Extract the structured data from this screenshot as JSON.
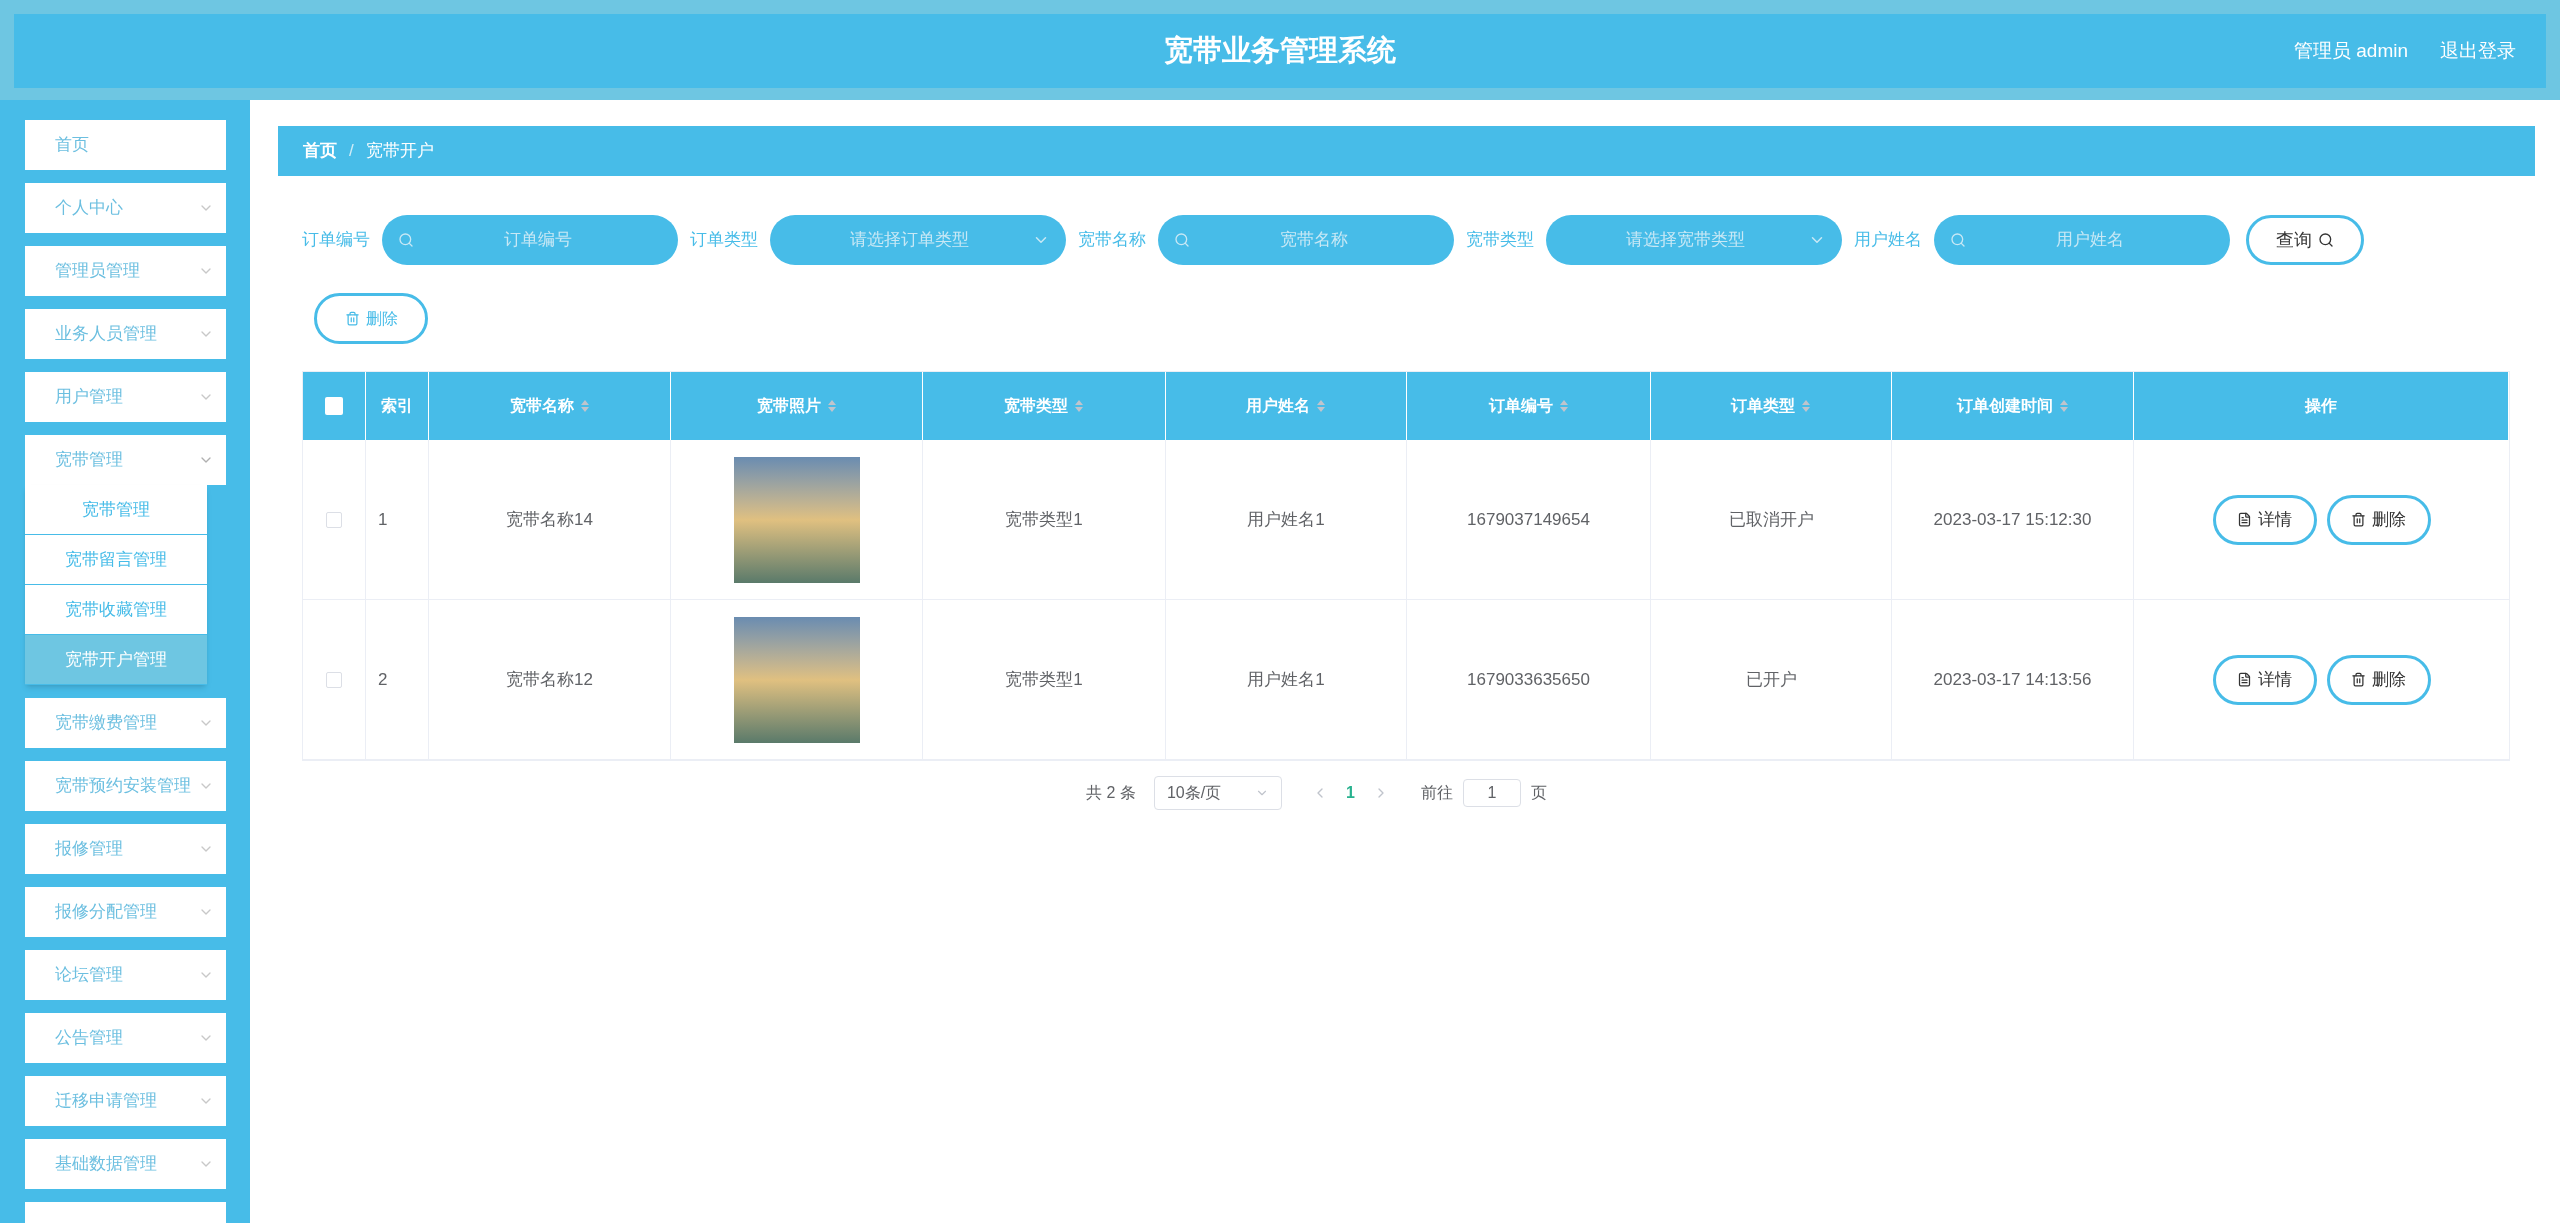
{
  "header": {
    "title": "宽带业务管理系统",
    "user": "管理员 admin",
    "logout": "退出登录"
  },
  "sidebar": {
    "items": [
      {
        "label": "首页",
        "kind": "link"
      },
      {
        "label": "个人中心",
        "kind": "menu",
        "expanded": false
      },
      {
        "label": "管理员管理",
        "kind": "menu",
        "expanded": false
      },
      {
        "label": "业务人员管理",
        "kind": "menu",
        "expanded": false
      },
      {
        "label": "用户管理",
        "kind": "menu",
        "expanded": false
      },
      {
        "label": "宽带管理",
        "kind": "menu",
        "expanded": true,
        "children": [
          {
            "label": "宽带管理",
            "selected": false
          },
          {
            "label": "宽带留言管理",
            "selected": false
          },
          {
            "label": "宽带收藏管理",
            "selected": false
          },
          {
            "label": "宽带开户管理",
            "selected": true
          }
        ]
      },
      {
        "label": "宽带缴费管理",
        "kind": "menu",
        "expanded": false
      },
      {
        "label": "宽带预约安装管理",
        "kind": "menu",
        "expanded": false
      },
      {
        "label": "报修管理",
        "kind": "menu",
        "expanded": false
      },
      {
        "label": "报修分配管理",
        "kind": "menu",
        "expanded": false
      },
      {
        "label": "论坛管理",
        "kind": "menu",
        "expanded": false
      },
      {
        "label": "公告管理",
        "kind": "menu",
        "expanded": false
      },
      {
        "label": "迁移申请管理",
        "kind": "menu",
        "expanded": false
      },
      {
        "label": "基础数据管理",
        "kind": "menu",
        "expanded": false
      },
      {
        "kind": "menu",
        "expanded": false
      }
    ]
  },
  "breadcrumb": [
    "首页",
    "宽带开户"
  ],
  "breadcrumb_separator": "/",
  "filters": [
    {
      "label": "订单编号",
      "kind": "input",
      "placeholder": "订单编号"
    },
    {
      "label": "订单类型",
      "kind": "select",
      "placeholder": "请选择订单类型"
    },
    {
      "label": "宽带名称",
      "kind": "input",
      "placeholder": "宽带名称"
    },
    {
      "label": "宽带类型",
      "kind": "select",
      "placeholder": "请选择宽带类型"
    },
    {
      "label": "用户姓名",
      "kind": "input",
      "placeholder": "用户姓名"
    }
  ],
  "search_button": "查询",
  "delete_button": "删除",
  "table": {
    "select_all_checked": false,
    "columns": [
      {
        "label": "索引",
        "sortable": false
      },
      {
        "label": "宽带名称",
        "sortable": true
      },
      {
        "label": "宽带照片",
        "sortable": true
      },
      {
        "label": "宽带类型",
        "sortable": true
      },
      {
        "label": "用户姓名",
        "sortable": true
      },
      {
        "label": "订单编号",
        "sortable": true
      },
      {
        "label": "订单类型",
        "sortable": true
      },
      {
        "label": "订单创建时间",
        "sortable": true
      },
      {
        "label": "操作",
        "sortable": false
      }
    ],
    "rows": [
      {
        "checked": false,
        "index": "1",
        "name": "宽带名称14",
        "type": "宽带类型1",
        "user": "用户姓名1",
        "order_no": "1679037149654",
        "order_type": "已取消开户",
        "created": "2023-03-17 15:12:30",
        "actions": [
          "详情",
          "删除"
        ]
      },
      {
        "checked": false,
        "index": "2",
        "name": "宽带名称12",
        "type": "宽带类型1",
        "user": "用户姓名1",
        "order_no": "1679033635650",
        "order_type": "已开户",
        "created": "2023-03-17 14:13:56",
        "actions": [
          "详情",
          "删除"
        ]
      }
    ]
  },
  "pagination": {
    "total": "共 2 条",
    "page_size": "10条/页",
    "pages": [
      {
        "label": "1",
        "selected": true
      }
    ],
    "goto_label": "前往",
    "goto_value": "1",
    "goto_suffix": "页"
  }
}
